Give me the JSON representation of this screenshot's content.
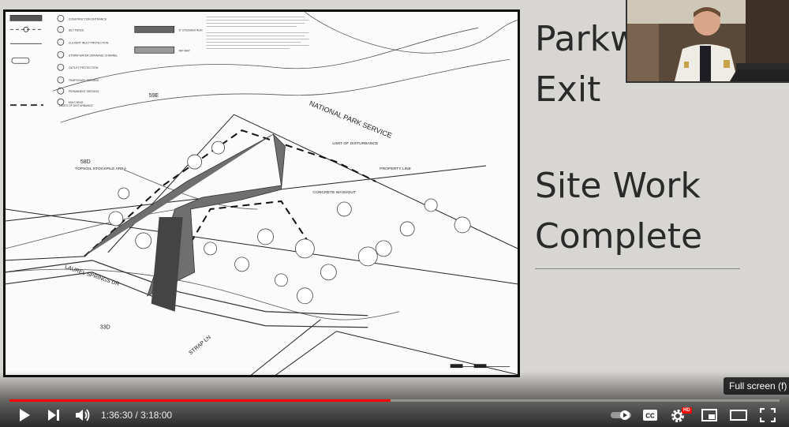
{
  "slide": {
    "title_line1": "Parkw",
    "title_line2": "Exit",
    "heading_line1": "Site Work",
    "heading_line2": "Complete"
  },
  "plan": {
    "label_national_park": "NATIONAL PARK SERVICE",
    "label_limit": "LIMIT OF DISTURBANCE",
    "label_property": "PROPERTY LINE",
    "label_washout": "CONCRETE WASHOUT",
    "label_topsoil": "TOPSOIL STOCKPILE AREA",
    "label_road": "LAUREL SPRINGS DR",
    "label_strap": "STRAP LN",
    "label_59e": "59E",
    "label_58d": "58D",
    "label_33d": "33D",
    "label_limits_legend": "LIMITS OF DISTURBANCE"
  },
  "player": {
    "progress_fraction": 0.495,
    "current_time": "1:36:30",
    "separator": " / ",
    "duration": "3:18:00",
    "fullscreen_tooltip": "Full screen (f)",
    "hd_badge": "HD",
    "cc_label": "CC"
  }
}
